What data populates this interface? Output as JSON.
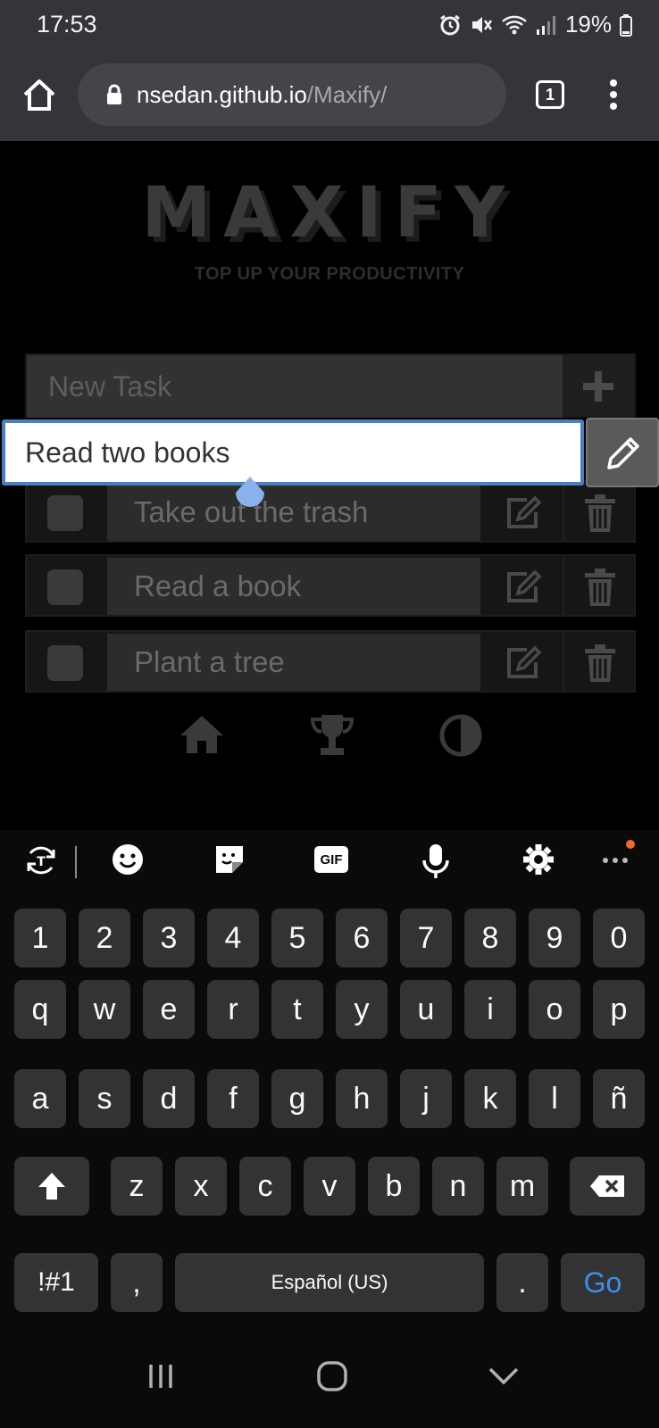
{
  "status": {
    "time": "17:53",
    "battery": "19%"
  },
  "browser": {
    "url_host": "nsedan.github.io",
    "url_path": "/Maxify/",
    "tab_count": "1"
  },
  "app": {
    "logo": "MAXIFY",
    "tagline": "TOP UP YOUR PRODUCTIVITY",
    "new_task_placeholder": "New Task",
    "edit_value": "Read two books",
    "tasks": [
      {
        "label": "Take out the trash"
      },
      {
        "label": "Read a book"
      },
      {
        "label": "Plant a tree"
      }
    ]
  },
  "keyboard": {
    "toolbar": [
      "translate-icon",
      "emoji-icon",
      "sticker-icon",
      "gif-icon",
      "mic-icon",
      "settings-icon",
      "more-icon"
    ],
    "gif_label": "GIF",
    "row_numbers": [
      "1",
      "2",
      "3",
      "4",
      "5",
      "6",
      "7",
      "8",
      "9",
      "0"
    ],
    "row_1": [
      "q",
      "w",
      "e",
      "r",
      "t",
      "y",
      "u",
      "i",
      "o",
      "p"
    ],
    "row_2": [
      "a",
      "s",
      "d",
      "f",
      "g",
      "h",
      "j",
      "k",
      "l",
      "ñ"
    ],
    "row_3": [
      "z",
      "x",
      "c",
      "v",
      "b",
      "n",
      "m"
    ],
    "symbols_key": "!#1",
    "comma_key": ",",
    "space_key": "Español (US)",
    "period_key": ".",
    "go_key": "Go"
  },
  "colors": {
    "accent": "#3d8fe8",
    "edit_border": "#4a7fc4",
    "keyboard_key": "#333336",
    "notification_dot": "#f06a2a"
  }
}
